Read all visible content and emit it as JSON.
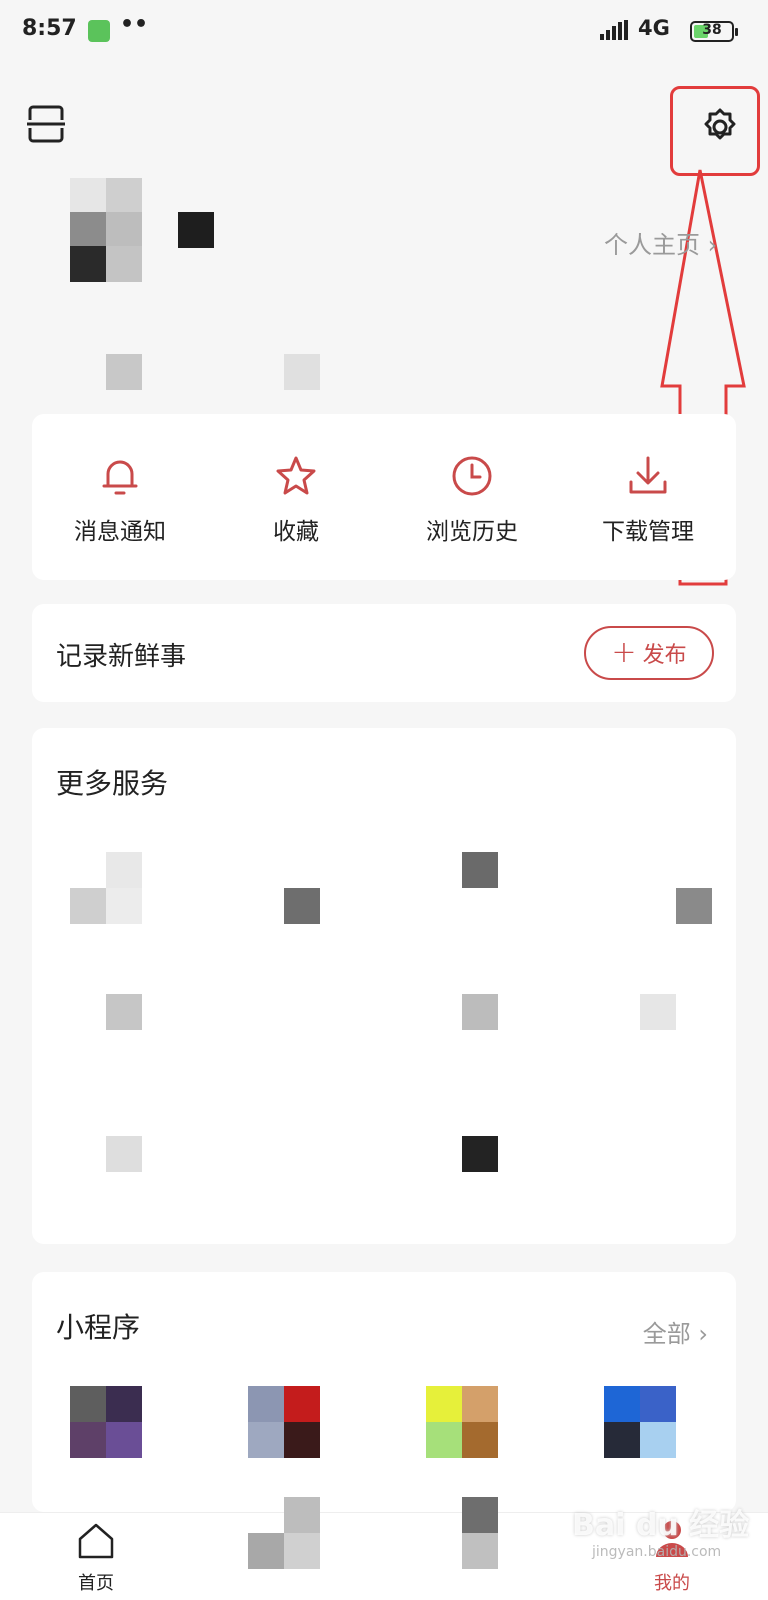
{
  "status_bar": {
    "time": "8:57",
    "dots": "••",
    "network": "4G",
    "battery": "38",
    "battery_level": 0.38
  },
  "header": {
    "scan_icon": "scan-icon",
    "settings_icon": "gear-icon"
  },
  "profile": {
    "homepage_link": "个人主页 ›"
  },
  "quick_actions": [
    {
      "label": "消息通知",
      "icon": "bell-icon"
    },
    {
      "label": "收藏",
      "icon": "star-icon"
    },
    {
      "label": "浏览历史",
      "icon": "clock-icon"
    },
    {
      "label": "下载管理",
      "icon": "download-icon"
    }
  ],
  "post": {
    "title": "记录新鲜事",
    "publish_label": "发布",
    "publish_icon": "plus-icon"
  },
  "services": {
    "title": "更多服务"
  },
  "mini_programs": {
    "title": "小程序",
    "all_link": "全部 ›"
  },
  "bottom_nav": [
    {
      "label": "首页",
      "icon": "home-icon",
      "active": false
    },
    {
      "label": "",
      "icon": "",
      "active": false
    },
    {
      "label": "",
      "icon": "",
      "active": false
    },
    {
      "label": "我的",
      "icon": "user-icon",
      "active": true
    }
  ],
  "watermark": {
    "text": "Bai du 经验",
    "sub": "jingyan.baidu.com"
  },
  "colors": {
    "accent": "#c94a4a",
    "highlight": "#e23c3c",
    "background": "#f6f6f6",
    "card": "#ffffff",
    "muted_text": "#9a9a9a"
  }
}
